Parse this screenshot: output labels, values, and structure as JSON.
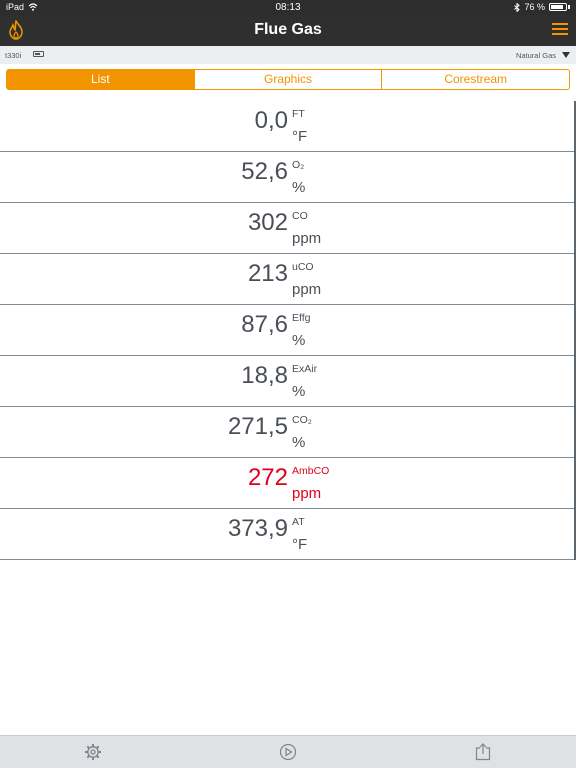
{
  "status_bar": {
    "device": "iPad",
    "time": "08:13",
    "battery": "76 %"
  },
  "nav": {
    "title": "Flue Gas"
  },
  "info": {
    "device": "t330i",
    "fuel": "Natural Gas"
  },
  "tabs": [
    {
      "label": "List",
      "active": true
    },
    {
      "label": "Graphics",
      "active": false
    },
    {
      "label": "Corestream",
      "active": false
    }
  ],
  "rows": [
    {
      "value": "0,0",
      "param": "FT",
      "unit": "°F"
    },
    {
      "value": "52,6",
      "param": "O₂",
      "unit": "%"
    },
    {
      "value": "302",
      "param": "CO",
      "unit": "ppm"
    },
    {
      "value": "213",
      "param": "uCO",
      "unit": "ppm"
    },
    {
      "value": "87,6",
      "param": "Effg",
      "unit": "%"
    },
    {
      "value": "18,8",
      "param": "ExAir",
      "unit": "%"
    },
    {
      "value": "271,5",
      "param": "CO₂",
      "unit": "%"
    },
    {
      "value": "272",
      "param": "AmbCO",
      "unit": "ppm",
      "alarm": true
    },
    {
      "value": "373,9",
      "param": "AT",
      "unit": "°F"
    }
  ],
  "colors": {
    "accent": "#f29400",
    "alarm": "#e2001a",
    "text": "#4a4f57",
    "nav_bg": "#2f2f2f"
  },
  "icons": {
    "app": "flame-icon",
    "menu": "menu-icon",
    "settings": "gear-icon",
    "play": "play-icon",
    "export": "share-icon"
  }
}
